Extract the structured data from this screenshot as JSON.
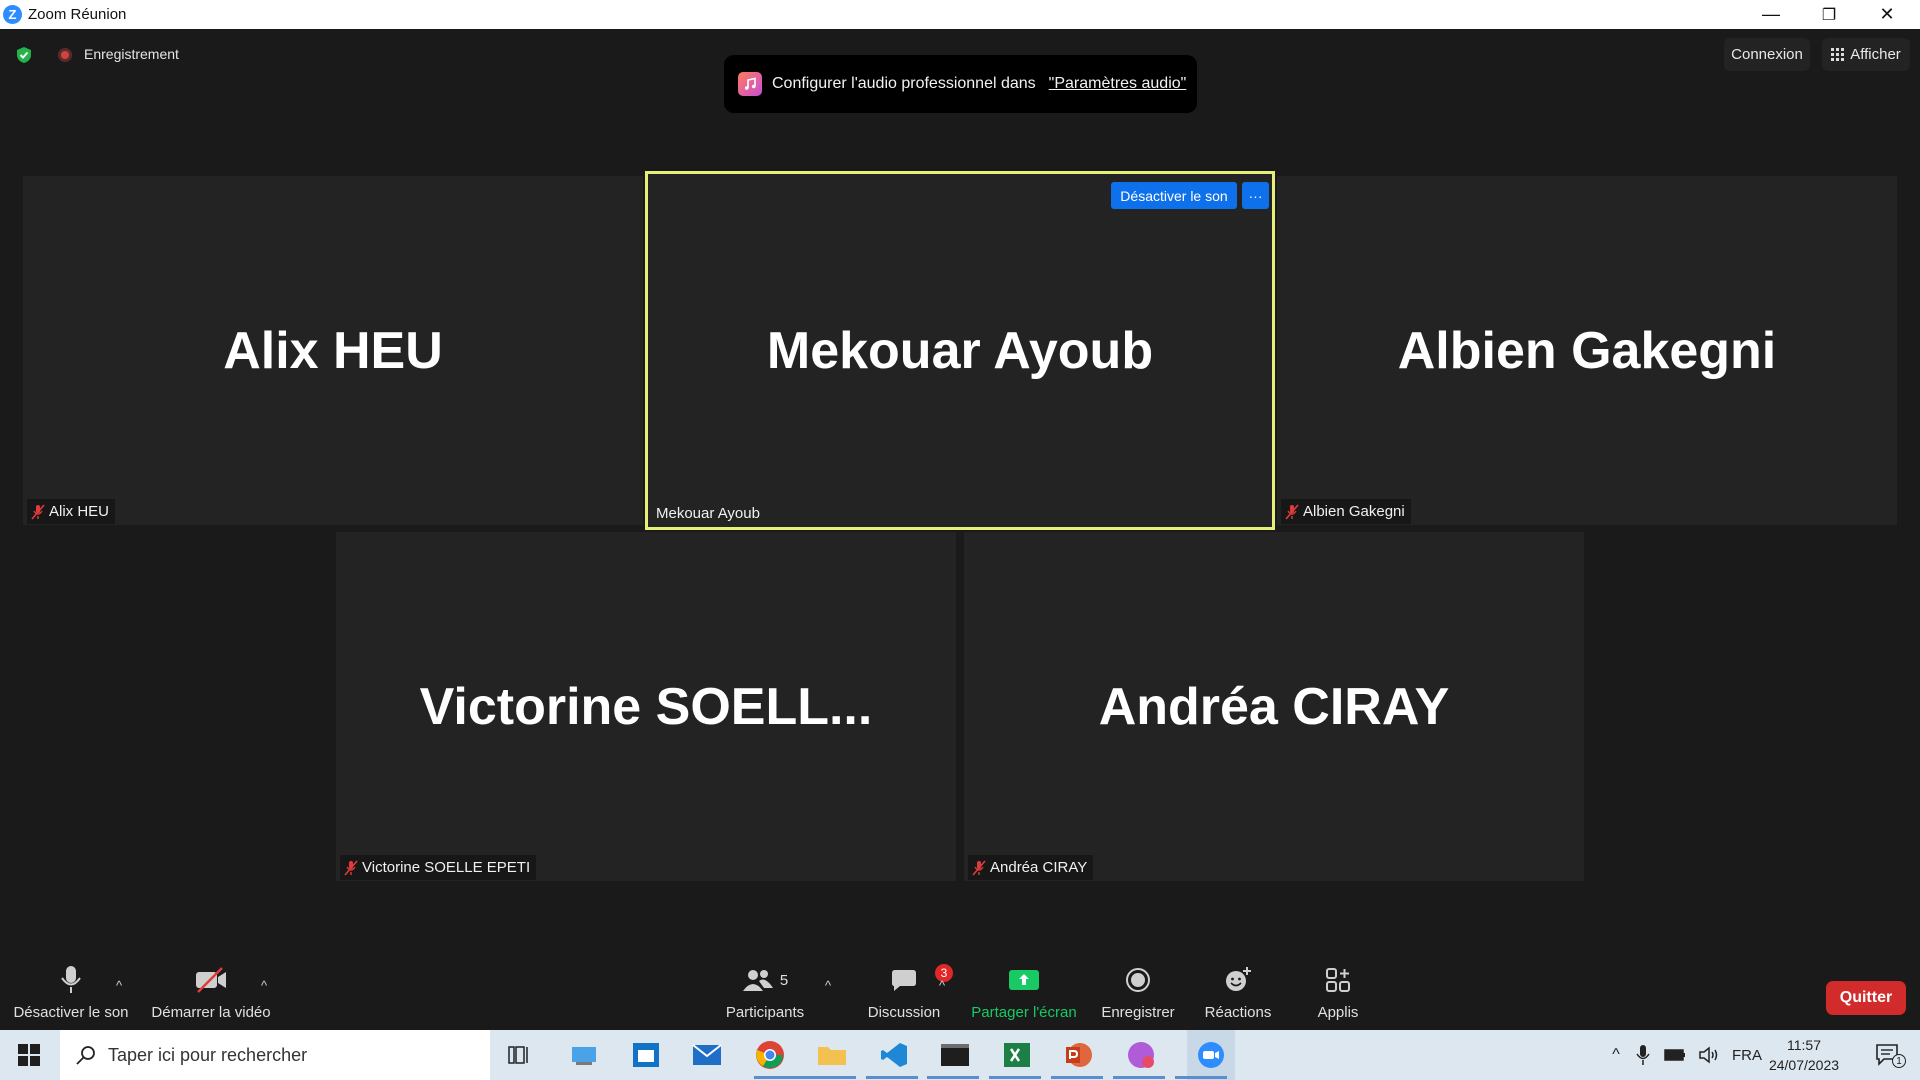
{
  "window": {
    "title": "Zoom Réunion",
    "minimize": "—",
    "restore": "❐",
    "close": "✕"
  },
  "top": {
    "recording_label": "Enregistrement",
    "connexion": "Connexion",
    "afficher": "Afficher"
  },
  "toast": {
    "text": "Configurer l'audio professionnel dans",
    "link": "\"Paramètres audio\""
  },
  "tiles": [
    {
      "big": "Alix HEU",
      "label": "Alix HEU",
      "muted": true
    },
    {
      "big": "Mekouar Ayoub",
      "label": "Mekouar Ayoub",
      "muted": false,
      "active": true
    },
    {
      "big": "Albien Gakegni",
      "label": "Albien Gakegni",
      "muted": true
    },
    {
      "big": "Victorine  SOELL...",
      "label": "Victorine SOELLE EPETI",
      "muted": true
    },
    {
      "big": "Andréa CIRAY",
      "label": "Andréa CIRAY",
      "muted": true
    }
  ],
  "active_tile": {
    "mute_button": "Désactiver le son",
    "more_button": "···"
  },
  "toolbar": {
    "mute": "Désactiver le son",
    "video": "Démarrer la vidéo",
    "participants": "Participants",
    "participants_count": "5",
    "chat": "Discussion",
    "chat_badge": "3",
    "share": "Partager l'écran",
    "record": "Enregistrer",
    "reactions": "Réactions",
    "apps": "Applis",
    "quit": "Quitter",
    "caret": "^"
  },
  "colors": {
    "share_green": "#18c964",
    "quit_red": "#d22b2b",
    "active_border": "#e8ee7a",
    "zoom_blue": "#0e71eb"
  },
  "taskbar": {
    "search_placeholder": "Taper ici pour rechercher",
    "language": "FRA",
    "time": "11:57",
    "date": "24/07/2023",
    "notification_count": "1",
    "tray_caret": "^",
    "icons": [
      "windows-icon",
      "task-view-icon",
      "explorer-icon",
      "calendar-icon",
      "mail-icon",
      "chrome-icon",
      "folder-icon",
      "vscode-icon",
      "terminal-icon",
      "excel-icon",
      "powerpoint-icon",
      "messenger-icon",
      "zoom-icon"
    ]
  }
}
